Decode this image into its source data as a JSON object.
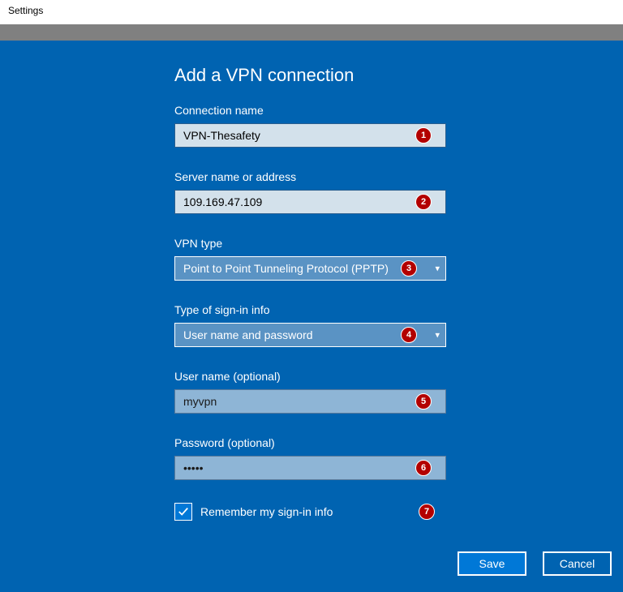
{
  "window": {
    "title": "Settings"
  },
  "heading": "Add a VPN connection",
  "fields": {
    "connection_name": {
      "label": "Connection name",
      "value": "VPN-Thesafety",
      "badge": "1"
    },
    "server": {
      "label": "Server name or address",
      "value": "109.169.47.109",
      "badge": "2"
    },
    "vpn_type": {
      "label": "VPN type",
      "value": "Point to Point Tunneling Protocol (PPTP)",
      "badge": "3"
    },
    "signin_type": {
      "label": "Type of sign-in info",
      "value": "User name and password",
      "badge": "4"
    },
    "username": {
      "label": "User name (optional)",
      "value": "myvpn",
      "badge": "5"
    },
    "password": {
      "label": "Password (optional)",
      "value": "•••••",
      "badge": "6"
    },
    "remember": {
      "label": "Remember my sign-in info",
      "checked": true,
      "badge": "7"
    }
  },
  "buttons": {
    "save": "Save",
    "cancel": "Cancel"
  }
}
